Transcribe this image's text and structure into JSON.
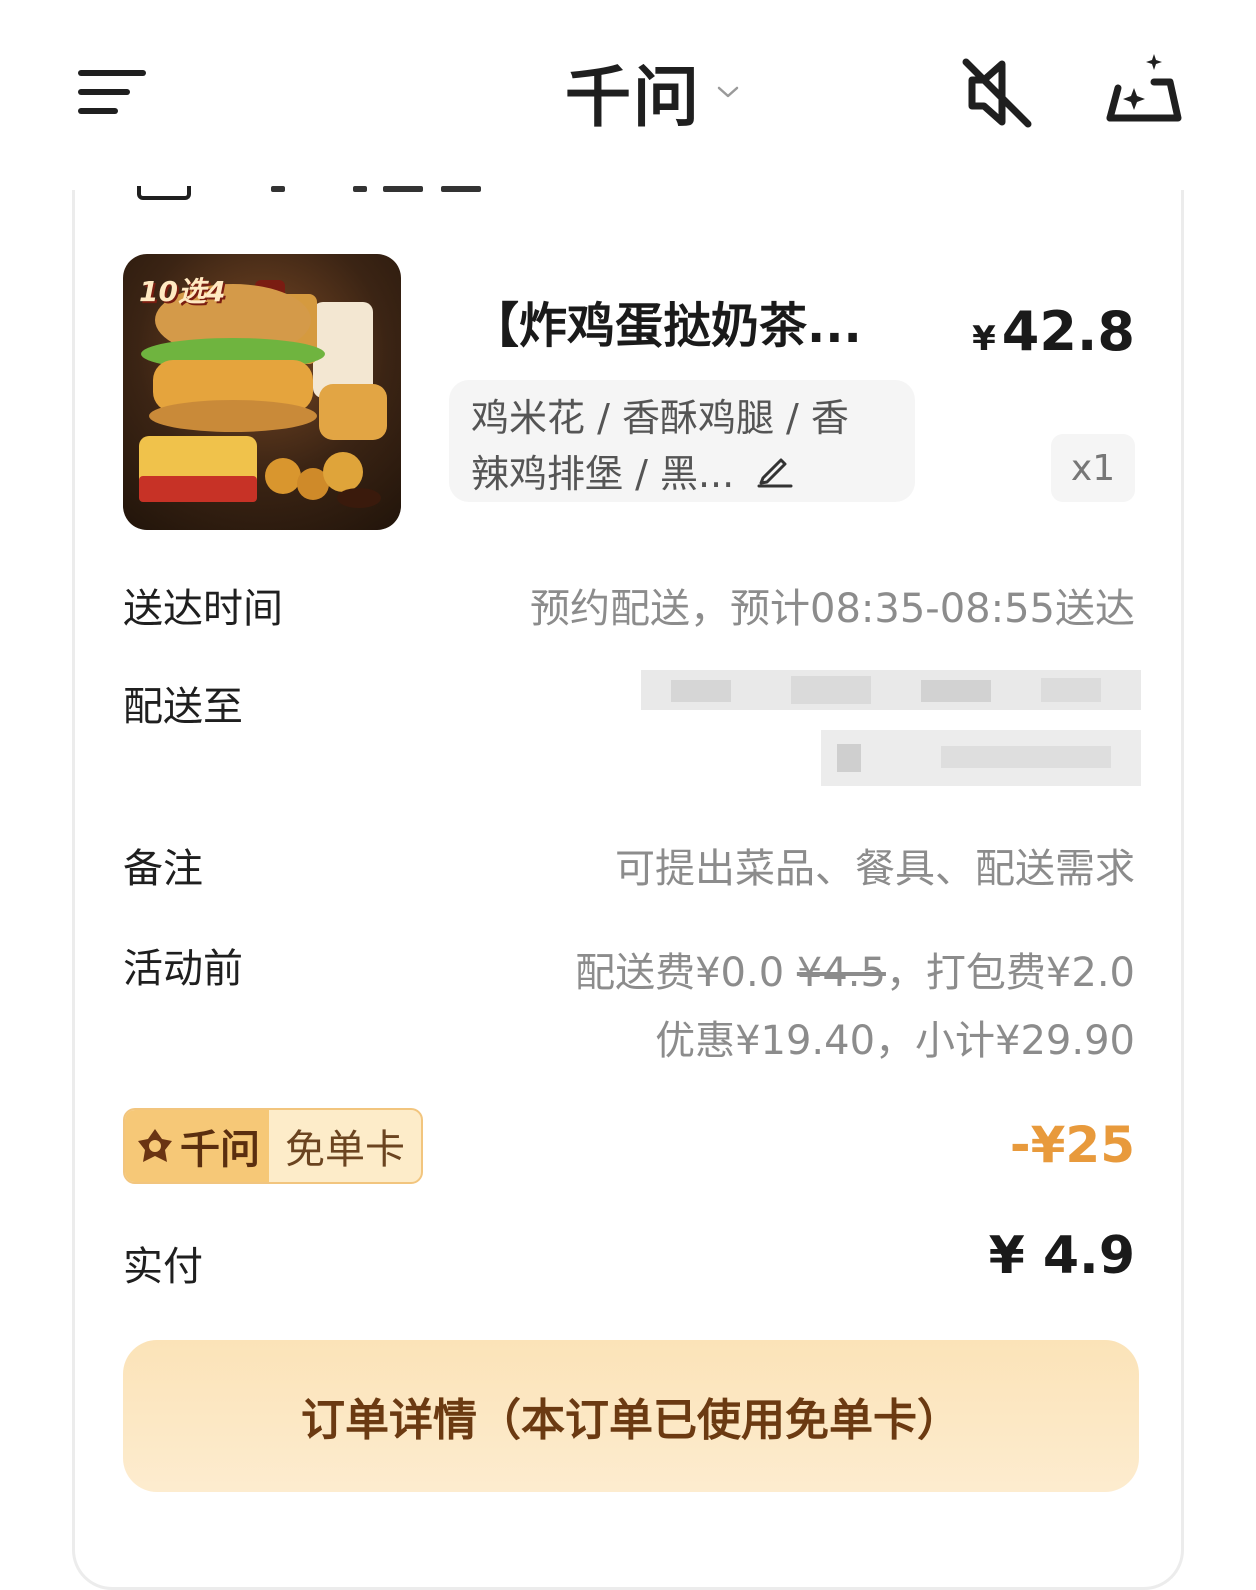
{
  "header": {
    "title": "千问",
    "menu_icon": "menu-icon",
    "mute_icon": "speaker-muted-icon",
    "sparkle_icon": "sparkle-cloud-icon"
  },
  "product": {
    "image_tag": "10选4",
    "name": "【炸鸡蛋挞奶茶...",
    "price_symbol": "¥",
    "price": "42.8",
    "options": "鸡米花 / 香酥鸡腿 / 香辣鸡排堡 / 黑...",
    "quantity": "x1"
  },
  "delivery_time": {
    "label": "送达时间",
    "value": "预约配送，预计08:35-08:55送达"
  },
  "address": {
    "label": "配送至"
  },
  "note": {
    "label": "备注",
    "placeholder": "可提出菜品、餐具、配送需求"
  },
  "pre_promo": {
    "label": "活动前",
    "line1_prefix": "配送费¥0.0 ",
    "line1_strike": "¥4.5",
    "line1_suffix": "，打包费¥2.0",
    "line2": "优惠¥19.40，小计¥29.90"
  },
  "free_card": {
    "brand": "千问",
    "label": "免单卡",
    "discount": "-¥25"
  },
  "paid": {
    "label": "实付",
    "value": "¥ 4.9"
  },
  "detail_button": {
    "label": "订单详情（本订单已使用免单卡）"
  },
  "colors": {
    "accent_orange": "#e89a3c",
    "button_bg": "#fbe3b8",
    "button_text": "#6b3a12"
  }
}
